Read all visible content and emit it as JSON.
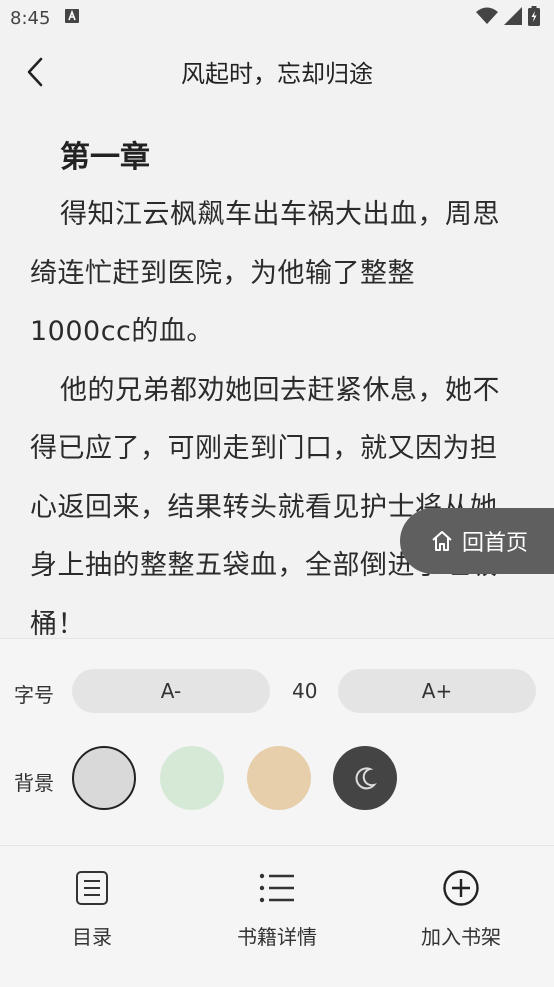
{
  "status_bar": {
    "time": "8:45"
  },
  "nav": {
    "title": "风起时，忘却归途"
  },
  "chapter": {
    "title": "第一章",
    "paragraphs": [
      "得知江云枫飙车出车祸大出血，周思绮连忙赶到医院，为他输了整整1000cc的血。",
      "他的兄弟都劝她回去赶紧休息，她不得已应了，可刚走到门口，就又因为担心返回来，结果转头就看见护士将从她身上抽的整整五袋血，全部倒进了垃圾桶！"
    ]
  },
  "home_button": {
    "label": "回首页"
  },
  "settings": {
    "font_size_label": "字号",
    "decrease_label": "A-",
    "font_size_value": "40",
    "increase_label": "A+",
    "background_label": "背景",
    "backgrounds": [
      {
        "name": "gray",
        "color": "#d9d9d9",
        "selected": true
      },
      {
        "name": "green",
        "color": "#d6e9d6"
      },
      {
        "name": "tan",
        "color": "#e6cfaa"
      },
      {
        "name": "night",
        "color": "#444444"
      }
    ]
  },
  "bottom_bar": {
    "items": [
      {
        "label": "目录",
        "icon": "toc-icon"
      },
      {
        "label": "书籍详情",
        "icon": "list-icon"
      },
      {
        "label": "加入书架",
        "icon": "plus-circle-icon"
      }
    ]
  }
}
